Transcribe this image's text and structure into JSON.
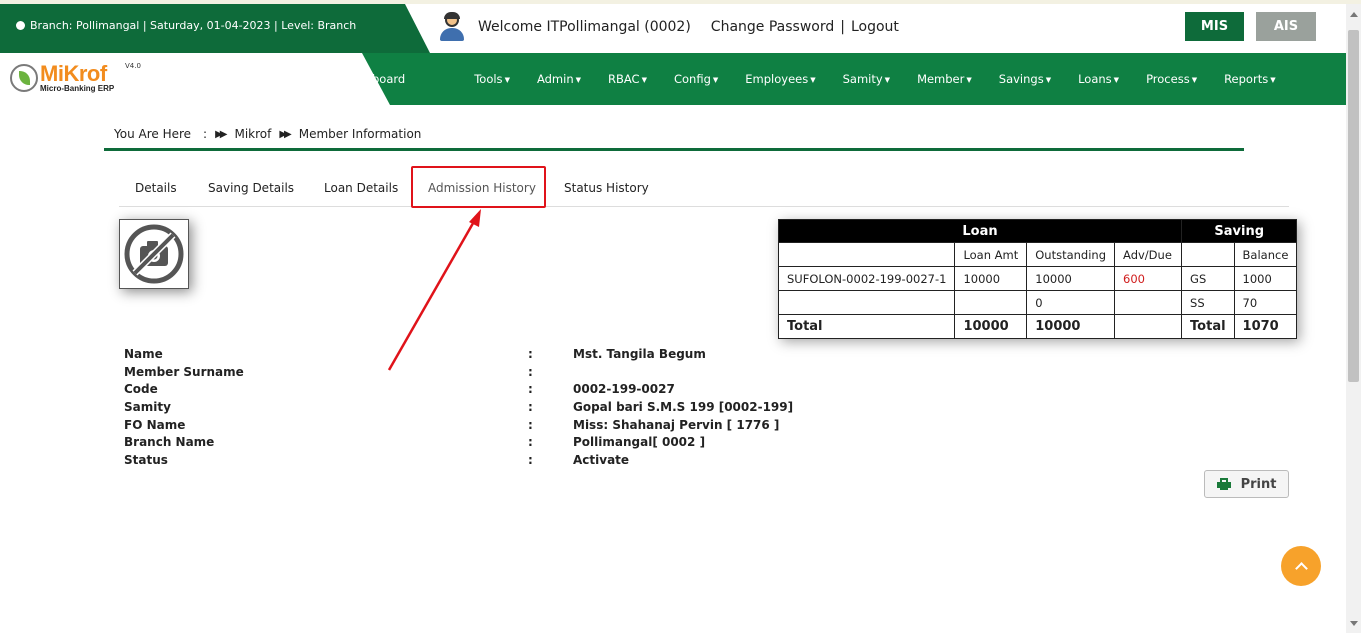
{
  "header": {
    "branch_info": "Branch: Pollimangal | Saturday, 01-04-2023 | Level: Branch",
    "welcome": "Welcome ITPollimangal (0002)",
    "change_password": "Change Password",
    "separator": "|",
    "logout": "Logout",
    "mis_label": "MIS",
    "ais_label": "AIS"
  },
  "logo": {
    "name": "MiKrof",
    "version": "V4.0",
    "subtitle": "Micro-Banking ERP"
  },
  "nav": {
    "items": [
      {
        "label": "board"
      },
      {
        "label": "Tools",
        "caret": "▼"
      },
      {
        "label": "Admin",
        "caret": "▼"
      },
      {
        "label": "RBAC",
        "caret": "▼"
      },
      {
        "label": "Config",
        "caret": "▼"
      },
      {
        "label": "Employees",
        "caret": "▼"
      },
      {
        "label": "Samity",
        "caret": "▼"
      },
      {
        "label": "Member",
        "caret": "▼"
      },
      {
        "label": "Savings",
        "caret": "▼"
      },
      {
        "label": "Loans",
        "caret": "▼"
      },
      {
        "label": "Process",
        "caret": "▼"
      },
      {
        "label": "Reports",
        "caret": "▼"
      }
    ]
  },
  "breadcrumb": {
    "prefix": "You Are Here",
    "colon": ":",
    "root": "Mikrof",
    "current": "Member Information"
  },
  "tabs": [
    {
      "label": "Details"
    },
    {
      "label": "Saving Details"
    },
    {
      "label": "Loan Details"
    },
    {
      "label": "Admission History"
    },
    {
      "label": "Status History"
    }
  ],
  "summary": {
    "loan_header": "Loan",
    "saving_header": "Saving",
    "columns": {
      "loan_amt": "Loan Amt",
      "outstanding": "Outstanding",
      "adv_due": "Adv/Due",
      "balance": "Balance"
    },
    "rows": [
      {
        "loan_code": "SUFOLON-0002-199-0027-1",
        "loan_amt": "10000",
        "outstanding": "10000",
        "adv_due": "600",
        "saving_type": "GS",
        "balance": "1000"
      },
      {
        "loan_code": "",
        "loan_amt": "",
        "outstanding": "0",
        "adv_due": "",
        "saving_type": "SS",
        "balance": "70"
      }
    ],
    "total": {
      "label": "Total",
      "loan_amt": "10000",
      "outstanding": "10000",
      "saving_label": "Total",
      "balance": "1070"
    },
    "adv_due_color": "#d01d1d"
  },
  "member": {
    "colon": ":",
    "fields": [
      {
        "label": "Name",
        "value": "Mst. Tangila Begum"
      },
      {
        "label": "Member Surname",
        "value": ""
      },
      {
        "label": "Code",
        "value": "0002-199-0027"
      },
      {
        "label": "Samity",
        "value": "Gopal bari S.M.S 199 [0002-199]"
      },
      {
        "label": "FO Name",
        "value": "Miss: Shahanaj Pervin [ 1776 ]"
      },
      {
        "label": "Branch Name",
        "value": "Pollimangal[ 0002 ]"
      },
      {
        "label": "Status",
        "value": "Activate"
      }
    ]
  },
  "actions": {
    "print_label": "Print"
  },
  "colors": {
    "brand_dark": "#0e6b3a",
    "brand": "#0f8043",
    "accent_orange": "#f7a22b",
    "annotation_red": "#e0131a"
  },
  "icons": {
    "branch_icon": "globe-icon",
    "user_icon": "user-avatar-icon",
    "photo_placeholder": "no-photo-camera-icon",
    "print_icon": "printer-icon",
    "scroll_top_icon": "chevron-up-icon"
  }
}
